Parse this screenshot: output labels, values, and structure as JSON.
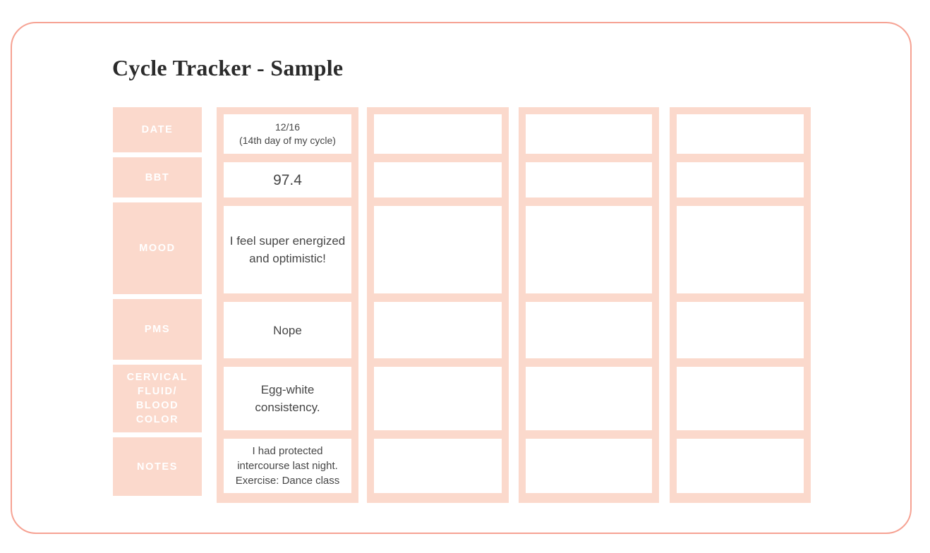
{
  "document": {
    "title": "Cycle Tracker - Sample"
  },
  "theme": {
    "peach_fill": "#FBD9CC",
    "frame_border": "#F6A293",
    "label_text": "#FFFFFF",
    "body_text": "#464646",
    "page_background": "#FFFFFF"
  },
  "table": {
    "row_labels": [
      "DATE",
      "BBT",
      "MOOD",
      "PMS",
      "CERVICAL FLUID/ BLOOD COLOR",
      "NOTES"
    ],
    "row_labels_lines": [
      [
        "DATE"
      ],
      [
        "BBT"
      ],
      [
        "MOOD"
      ],
      [
        "PMS"
      ],
      [
        "CERVICAL",
        "FLUID/",
        "BLOOD COLOR"
      ],
      [
        "NOTES"
      ]
    ],
    "columns": [
      {
        "name": "entry-1",
        "cells": {
          "date": "12/16\n(14th day of my cycle)",
          "date_line1": "12/16",
          "date_line2": "(14th day of my cycle)",
          "bbt": "97.4",
          "mood": "I feel super energized and optimistic!",
          "pms": "Nope",
          "cervical_fluid": "Egg-white consistency.",
          "notes": "I had protected intercourse last night. Exercise: Dance class"
        }
      },
      {
        "name": "entry-2",
        "cells": {
          "date_line1": "",
          "date_line2": "",
          "bbt": "",
          "mood": "",
          "pms": "",
          "cervical_fluid": "",
          "notes": ""
        }
      },
      {
        "name": "entry-3",
        "cells": {
          "date_line1": "",
          "date_line2": "",
          "bbt": "",
          "mood": "",
          "pms": "",
          "cervical_fluid": "",
          "notes": ""
        }
      },
      {
        "name": "entry-4",
        "cells": {
          "date_line1": "",
          "date_line2": "",
          "bbt": "",
          "mood": "",
          "pms": "",
          "cervical_fluid": "",
          "notes": ""
        }
      }
    ]
  }
}
